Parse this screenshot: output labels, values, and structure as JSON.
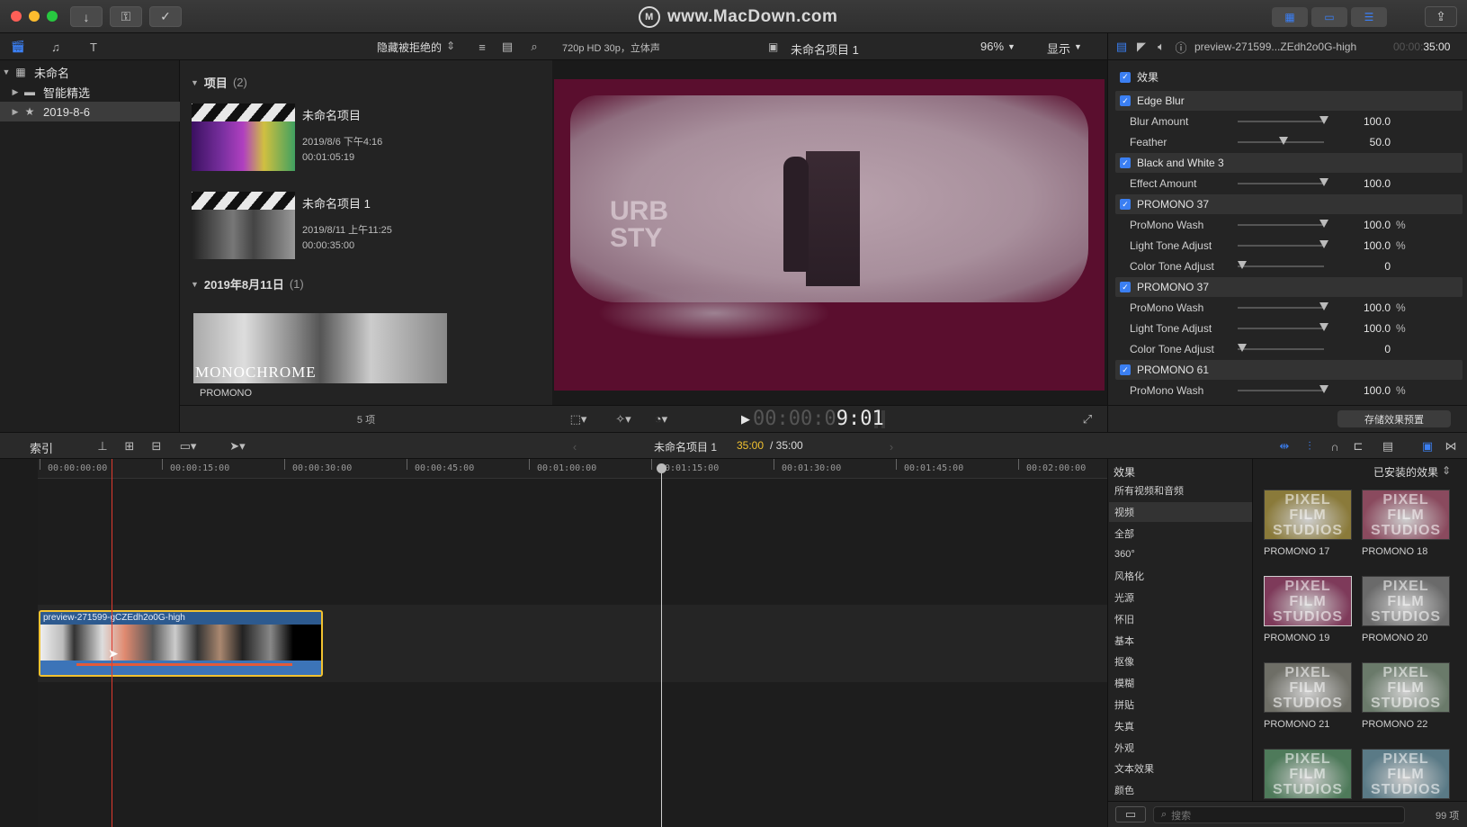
{
  "window": {
    "watermark": "www.MacDown.com"
  },
  "library": {
    "items": [
      {
        "label": "未命名"
      },
      {
        "label": "智能精选"
      },
      {
        "label": "2019-8-6"
      }
    ]
  },
  "browser": {
    "filter_label": "隐藏被拒绝的",
    "projects_header": "项目",
    "projects_count": "(2)",
    "projects": [
      {
        "title": "未命名项目",
        "date": "2019/8/6 下午4:16",
        "duration": "00:01:05:19"
      },
      {
        "title": "未命名项目 1",
        "date": "2019/8/11 上午11:25",
        "duration": "00:00:35:00"
      }
    ],
    "event_header": "2019年8月11日",
    "event_count": "(1)",
    "clip_label": "PROMONO",
    "monochrome_text": "MONOCHROME",
    "footer_count": "5 项"
  },
  "viewer": {
    "format": "720p HD 30p，立体声",
    "project_name": "未命名项目 1",
    "zoom": "96%",
    "display_label": "显示",
    "overlay_text_1": "URB",
    "overlay_text_2": "STY",
    "timecode_dim": "00:00:0",
    "timecode_bright": "9:01"
  },
  "inspector": {
    "clip_name": "preview-271599...ZEdh2o0G-high",
    "timecode_dim": "00:00:",
    "timecode": "35:00",
    "effects_header": "效果",
    "effects": [
      {
        "name": "Edge Blur",
        "params": [
          {
            "name": "Blur Amount",
            "value": "100.0",
            "unit": "",
            "level": 1.0
          },
          {
            "name": "Feather",
            "value": "50.0",
            "unit": "",
            "level": 0.5
          }
        ]
      },
      {
        "name": "Black and White 3",
        "params": [
          {
            "name": "Effect Amount",
            "value": "100.0",
            "unit": "",
            "level": 1.0
          }
        ]
      },
      {
        "name": "PROMONO 37",
        "params": [
          {
            "name": "ProMono Wash",
            "value": "100.0",
            "unit": "%",
            "level": 1.0
          },
          {
            "name": "Light Tone Adjust",
            "value": "100.0",
            "unit": "%",
            "level": 1.0
          },
          {
            "name": "Color Tone Adjust",
            "value": "0",
            "unit": "",
            "level": 0.0
          }
        ]
      },
      {
        "name": "PROMONO 37",
        "params": [
          {
            "name": "ProMono Wash",
            "value": "100.0",
            "unit": "%",
            "level": 1.0
          },
          {
            "name": "Light Tone Adjust",
            "value": "100.0",
            "unit": "%",
            "level": 1.0
          },
          {
            "name": "Color Tone Adjust",
            "value": "0",
            "unit": "",
            "level": 0.0
          }
        ]
      },
      {
        "name": "PROMONO 61",
        "params": [
          {
            "name": "ProMono Wash",
            "value": "100.0",
            "unit": "%",
            "level": 1.0
          }
        ]
      }
    ],
    "save_preset_label": "存储效果预置"
  },
  "timeline": {
    "index_label": "索引",
    "project_name": "未命名项目 1",
    "position": "35:00",
    "duration": "/ 35:00",
    "ruler_labels": [
      "00:00:00:00",
      "00:00:15:00",
      "00:00:30:00",
      "00:00:45:00",
      "00:01:00:00",
      "00:01:15:00",
      "00:01:30:00",
      "00:01:45:00",
      "00:02:00:00"
    ],
    "clip_name": "preview-271599-gCZEdh2o0G-high"
  },
  "effects_browser": {
    "header": "效果",
    "installed_label": "已安装的效果",
    "categories": [
      "所有视频和音频",
      "视频",
      "全部",
      "360°",
      "风格化",
      "光源",
      "怀旧",
      "基本",
      "抠像",
      "模糊",
      "拼贴",
      "失真",
      "外观",
      "文本效果",
      "颜色"
    ],
    "selected_category": "视频",
    "tile_watermark_1": "PIXEL FILM",
    "tile_watermark_2": "STUDIOS",
    "tiles": [
      {
        "name": "PROMONO 17",
        "tint": "#8a7a3a"
      },
      {
        "name": "PROMONO 18",
        "tint": "#8a4a5e"
      },
      {
        "name": "PROMONO 19",
        "tint": "#7e3a5a"
      },
      {
        "name": "PROMONO 20",
        "tint": "#6a6a6a"
      },
      {
        "name": "PROMONO 21",
        "tint": "#6e6e66"
      },
      {
        "name": "PROMONO 22",
        "tint": "#6a7a6a"
      },
      {
        "name": "",
        "tint": "#4e7a5a"
      },
      {
        "name": "",
        "tint": "#5a7a86"
      }
    ],
    "search_placeholder": "搜索",
    "count": "99 项"
  },
  "colors": {
    "accent": "#3b7ff2",
    "clip_border": "#f2c230",
    "playhead": "#e03a2e",
    "viewer_bg": "#5a0e2e"
  }
}
